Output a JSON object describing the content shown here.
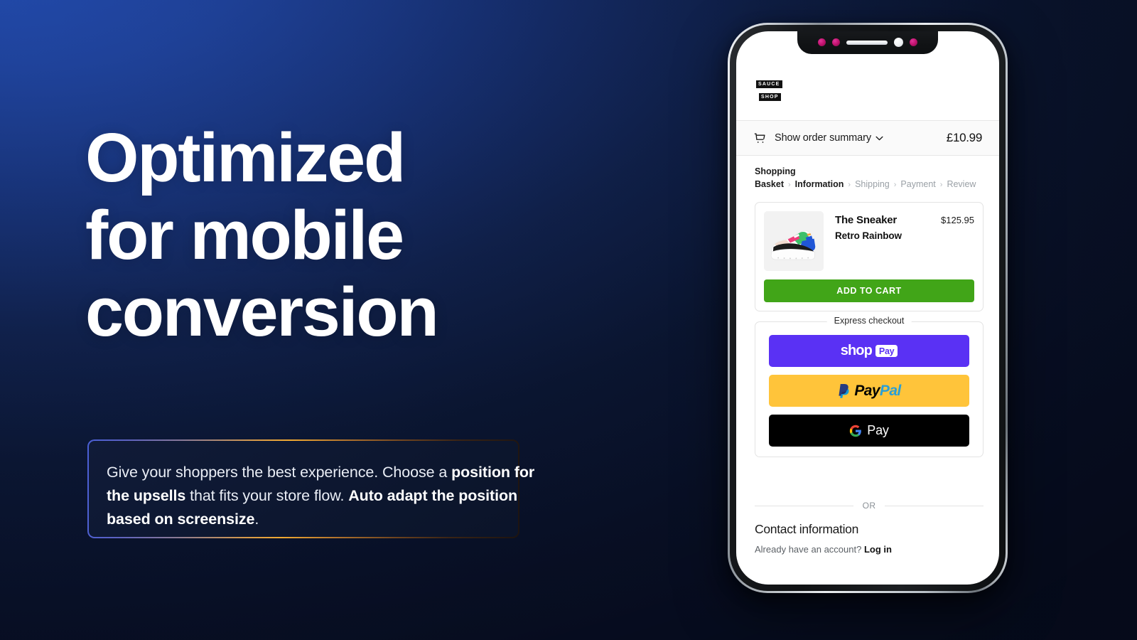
{
  "background": {
    "color_top_left": "#1e4199",
    "color_bottom_right": "#0a1129"
  },
  "hero": {
    "headline": "Optimized\nfor mobile\nconversion",
    "callout": {
      "segments": [
        {
          "text": "Give your shoppers the best experience. Choose a ",
          "bold": false
        },
        {
          "text": "position for the upsells",
          "bold": true
        },
        {
          "text": " that fits your store flow. ",
          "bold": false
        },
        {
          "text": "Auto adapt the position based on screensize",
          "bold": true
        },
        {
          "text": ".",
          "bold": false
        }
      ],
      "border_gradient_from": "#4a5fd6",
      "border_gradient_mid": "#f0a932",
      "border_gradient_to": "#1d1410"
    }
  },
  "phone": {
    "notch": {
      "sensor_color": "#c3136f",
      "speaker_label": "speaker-slot",
      "camera_label": "front-camera"
    },
    "store": {
      "logo_line1": "SAUCE",
      "logo_line2": "SHOP"
    },
    "order_summary": {
      "cart_icon": "shopping-cart-icon",
      "label": "Show order summary",
      "chevron": "⌄",
      "total": "£10.99"
    },
    "breadcrumb": {
      "separator": "›",
      "items": [
        {
          "label": "Shopping Basket",
          "active": true
        },
        {
          "label": "Information",
          "active": true
        },
        {
          "label": "Shipping",
          "active": false
        },
        {
          "label": "Payment",
          "active": false
        },
        {
          "label": "Review",
          "active": false
        }
      ]
    },
    "product": {
      "image_alt": "sneaker-product-image",
      "title": "The Sneaker",
      "variant": "Retro Rainbow",
      "price": "$125.95",
      "cta_label": "ADD TO CART",
      "cta_color": "#41a518"
    },
    "express_checkout": {
      "legend": "Express checkout",
      "buttons": [
        {
          "name": "shop-pay",
          "text_primary": "shop",
          "text_badge": "Pay",
          "bg": "#5a31f4"
        },
        {
          "name": "paypal",
          "text_primary": "Pay",
          "text_secondary": "Pal",
          "bg": "#ffc43a"
        },
        {
          "name": "google-pay",
          "text_primary": "Pay",
          "bg": "#000000"
        }
      ]
    },
    "divider": {
      "label": "OR"
    },
    "contact": {
      "title": "Contact information",
      "prompt": "Already have an account?",
      "login_label": "Log in"
    }
  }
}
